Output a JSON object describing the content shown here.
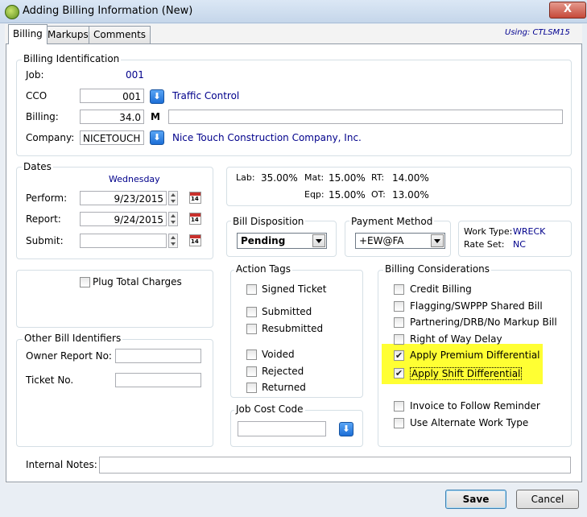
{
  "window": {
    "title": "Adding Billing Information  (New)",
    "close_label": "X"
  },
  "tabs": [
    {
      "label": "Billing"
    },
    {
      "label": "Markups"
    },
    {
      "label": "Comments"
    }
  ],
  "using": "Using:  CTLSM15",
  "billing_id": {
    "title": "Billing Identification",
    "job_label": "Job:",
    "job_value": "001",
    "cco_label": "CCO",
    "cco_value": "001",
    "cco_desc": "Traffic Control",
    "billing_label": "Billing:",
    "billing_value": "34.0",
    "billing_unit": "M",
    "billing_desc": "",
    "company_label": "Company:",
    "company_value": "NICETOUCH",
    "company_desc": "Nice Touch Construction Company, Inc."
  },
  "dates": {
    "title": "Dates",
    "day_name": "Wednesday",
    "perform_label": "Perform:",
    "perform_value": "9/23/2015",
    "report_label": "Report:",
    "report_value": "9/24/2015",
    "submit_label": "Submit:",
    "submit_value": "",
    "cal_label": "14"
  },
  "rates": {
    "lab_label": "Lab:",
    "lab_value": "35.00%",
    "mat_label": "Mat:",
    "mat_value": "15.00%",
    "rt_label": "RT:",
    "rt_value": "14.00%",
    "eqp_label": "Eqp:",
    "eqp_value": "15.00%",
    "ot_label": "OT:",
    "ot_value": "13.00%"
  },
  "bill_disposition": {
    "title": "Bill Disposition",
    "value": "Pending"
  },
  "payment_method": {
    "title": "Payment Method",
    "value": "+EW@FA"
  },
  "work_info": {
    "type_label": "Work Type:",
    "type_value": "WRECK",
    "rate_label": "Rate Set:",
    "rate_value": "NC"
  },
  "plug_total": {
    "label": "Plug Total Charges",
    "checked": false
  },
  "other_ids": {
    "title": "Other Bill Identifiers",
    "owner_label": "Owner Report No:",
    "owner_value": "",
    "ticket_label": "Ticket No.",
    "ticket_value": ""
  },
  "action_tags": {
    "title": "Action Tags",
    "items": [
      {
        "label": "Signed Ticket",
        "checked": false
      },
      {
        "label": "Submitted",
        "checked": false
      },
      {
        "label": "Resubmitted",
        "checked": false
      },
      {
        "label": "Voided",
        "checked": false
      },
      {
        "label": "Rejected",
        "checked": false
      },
      {
        "label": "Returned",
        "checked": false
      }
    ]
  },
  "job_cost_code": {
    "title": "Job Cost Code",
    "value": ""
  },
  "considerations": {
    "title": "Billing Considerations",
    "items": [
      {
        "label": "Credit Billing",
        "checked": false
      },
      {
        "label": "Flagging/SWPPP Shared Bill",
        "checked": false
      },
      {
        "label": "Partnering/DRB/No Markup Bill",
        "checked": false
      },
      {
        "label": "Right of Way Delay",
        "checked": false
      },
      {
        "label": "Apply Premium Differential",
        "checked": true
      },
      {
        "label": "Apply Shift Differential",
        "checked": true
      },
      {
        "label": "Invoice to Follow Reminder",
        "checked": false
      },
      {
        "label": "Use Alternate Work Type",
        "checked": false
      }
    ]
  },
  "notes": {
    "label": "Internal Notes:",
    "value": ""
  },
  "buttons": {
    "save": "Save",
    "cancel": "Cancel"
  },
  "checkmark": "✔",
  "dropdown_glyph": "⬇"
}
